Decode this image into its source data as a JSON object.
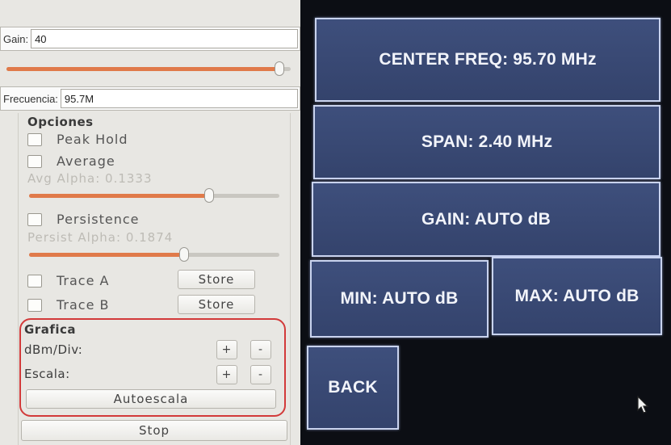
{
  "left_panel": {
    "gain": {
      "label": "Gain:",
      "value": "40",
      "slider_fraction": 0.96
    },
    "frequency": {
      "label": "Frecuencia:",
      "value": "95.7M"
    },
    "options": {
      "title": "Opciones",
      "peak_hold": "Peak Hold",
      "average": "Average",
      "avg_alpha": "Avg Alpha: 0.1333",
      "avg_slider_fraction": 0.72,
      "persistence": "Persistence",
      "persist_alpha": "Persist Alpha: 0.1874",
      "persist_slider_fraction": 0.62,
      "trace_a": "Trace A",
      "trace_b": "Trace B",
      "store_label": "Store"
    },
    "grafica": {
      "title": "Grafica",
      "dbm_div": "dBm/Div:",
      "escala": "Escala:",
      "plus": "+",
      "minus": "-",
      "autoescala": "Autoescala"
    },
    "stop_label": "Stop"
  },
  "touchscreen": {
    "center_freq": "CENTER FREQ: 95.70 MHz",
    "span": "SPAN: 2.40 MHz",
    "gain": "GAIN: AUTO dB",
    "min": "MIN: AUTO dB",
    "max": "MAX: AUTO dB",
    "back": "BACK"
  },
  "colors": {
    "slider_fill": "#e07a4a",
    "highlight_box": "#d23a3a",
    "button_blue": "#3e4f7c"
  }
}
